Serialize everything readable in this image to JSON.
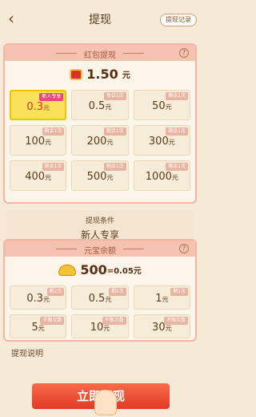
{
  "header": {
    "title": "提现",
    "record_label": "提现记录"
  },
  "red_packet": {
    "title": "红包提现",
    "balance_num": "1.50",
    "balance_unit": "元",
    "options": [
      {
        "value": "0.3",
        "unit": "元",
        "badge": "新人专享",
        "selected": true
      },
      {
        "value": "0.5",
        "unit": "元",
        "badge": "每日1次"
      },
      {
        "value": "50",
        "unit": "元",
        "badge": "剩余1次"
      },
      {
        "value": "100",
        "unit": "元",
        "badge": "剩余1次"
      },
      {
        "value": "200",
        "unit": "元",
        "badge": "剩余1次"
      },
      {
        "value": "300",
        "unit": "元",
        "badge": "剩余1次"
      },
      {
        "value": "400",
        "unit": "元",
        "badge": "剩余1次"
      },
      {
        "value": "500",
        "unit": "元",
        "badge": "剩余1次"
      },
      {
        "value": "1000",
        "unit": "元",
        "badge": "剩余1次"
      }
    ],
    "condition_title": "提现条件",
    "condition_value": "新人专享"
  },
  "ingot": {
    "title": "元宝余额",
    "balance_text": "500",
    "exchange_text": "=0.05元",
    "options": [
      {
        "value": "0.3",
        "unit": "元",
        "badge": "剩2次"
      },
      {
        "value": "0.5",
        "unit": "元",
        "badge": "剩2次"
      },
      {
        "value": "1",
        "unit": "元",
        "badge": "剩1次"
      },
      {
        "value": "5",
        "unit": "元",
        "badge": "不限次数"
      },
      {
        "value": "10",
        "unit": "元",
        "badge": "不限次数"
      },
      {
        "value": "30",
        "unit": "元",
        "badge": "不限次数"
      }
    ]
  },
  "explain_label": "提现说明",
  "withdraw_button": "立即提现",
  "colors": {
    "accent": "#e23b26",
    "selected": "#fbe05a",
    "badge_new": "#e8467d"
  }
}
